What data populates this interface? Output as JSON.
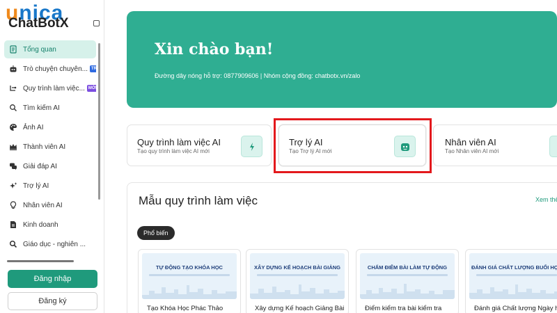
{
  "logo": {
    "watermark": "unica",
    "brand": "ChatBotX"
  },
  "sidebar": {
    "items": [
      {
        "label": "Tổng quan",
        "icon": "document-icon"
      },
      {
        "label": "Trò chuyện chuyên...",
        "icon": "bot-icon",
        "badge": "TRỢ CỤ"
      },
      {
        "label": "Quy trình làm việc...",
        "icon": "workflow-icon",
        "badge": "MỚI"
      },
      {
        "label": "Tìm kiếm AI",
        "icon": "search-icon"
      },
      {
        "label": "Ảnh AI",
        "icon": "palette-icon"
      },
      {
        "label": "Thành viên AI",
        "icon": "crown-icon"
      },
      {
        "label": "Giải đáp AI",
        "icon": "chat-icon"
      },
      {
        "label": "Trợ lý AI",
        "icon": "sparkle-icon"
      },
      {
        "label": "Nhân viên AI",
        "icon": "lightbulb-icon"
      },
      {
        "label": "Kinh doanh",
        "icon": "doc-icon"
      },
      {
        "label": "Giáo dục - nghiên ...",
        "icon": "search-icon"
      }
    ],
    "login_label": "Đăng nhập",
    "register_label": "Đăng ký"
  },
  "hero": {
    "title": "Xin chào bạn!",
    "subtitle": "Đường dây nóng hỗ trợ: 0877909606 | Nhóm cộng đồng: chatbotx.vn/zalo"
  },
  "feature_cards": [
    {
      "title": "Quy trình làm việc AI",
      "subtitle": "Tạo quy trình làm việc AI mới",
      "icon": "bolt-icon"
    },
    {
      "title": "Trợ lý AI",
      "subtitle": "Tạo Trợ lý AI mới",
      "icon": "robot-face-icon"
    },
    {
      "title": "Nhân viên AI",
      "subtitle": "Tạo Nhân viên AI mới",
      "icon": "layers-icon"
    }
  ],
  "templates_section": {
    "title": "Mẫu quy trình làm việc",
    "see_more": "Xem thêm",
    "filter_chip": "Phổ biến",
    "templates": [
      {
        "thumb_title": "TỰ ĐỘNG TẠO KHÓA HỌC",
        "label": "Tạo Khóa Học Phác Thảo"
      },
      {
        "thumb_title": "XÂY DỰNG KẾ HOẠCH BÀI GIẢNG",
        "label": "Xây dựng Kế hoạch Giảng Bài"
      },
      {
        "thumb_title": "CHẤM ĐIỂM BÀI LÀM TỰ ĐỘNG",
        "label": "Điểm kiểm tra bài kiểm tra"
      },
      {
        "thumb_title": "ĐÁNH GIÁ CHẤT LƯỢNG BUỔI HỌC",
        "label": "Đánh giá Chất lượng Ngày học"
      }
    ]
  },
  "colors": {
    "brand_green": "#2fae92",
    "button_green": "#1f9a7c",
    "active_nav_bg": "#d6f1ea",
    "highlight_red": "#e3181c"
  }
}
